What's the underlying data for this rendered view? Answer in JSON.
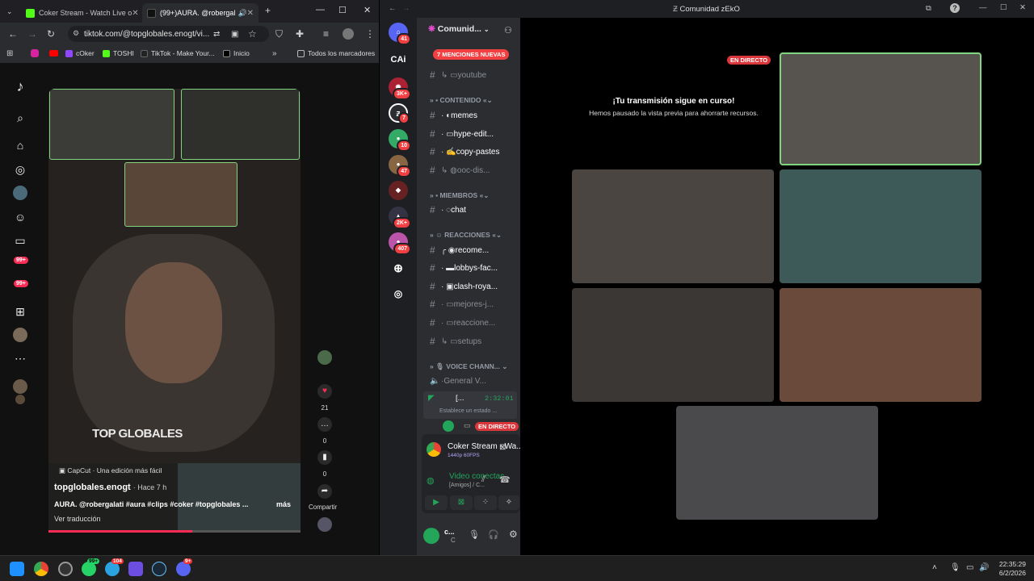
{
  "browser": {
    "tabs": [
      {
        "label": "Coker Stream - Watch Live o"
      },
      {
        "label": "(99+)AURA. @robergal"
      }
    ],
    "new_tab": "+",
    "address": "tiktok.com/@topglobales.enogt/vi...",
    "bookmarks": [
      "cOker",
      "TOSHI",
      "TikTok - Make Your...",
      "Inicio"
    ],
    "bookmarks_more": "»",
    "all_bookmarks": "Todos los marcadores"
  },
  "tiktok": {
    "sidebar_badges": [
      "99+",
      "99+"
    ],
    "overlay_text": "TOP GLOBALES",
    "capcut": "CapCut · Una edición más fácil",
    "author": "topglobales.enogt",
    "time": "· Hace 7 h",
    "caption": "AURA. @robergalati #aura #clips #coker #topglobales ...",
    "more": "más",
    "translate": "Ver traducción",
    "likes": "21",
    "comments": "0",
    "saves": "0",
    "share": "Compartir"
  },
  "discord": {
    "window_title": "Comunidad zEkO",
    "server_name": "Comunid...",
    "mentions_pill": "7 MENCIONES NUEVAS",
    "guild_badges": [
      "41",
      "3K+",
      "7",
      "10",
      "47",
      "2K+",
      "407"
    ],
    "guild_label_cai": "CAi",
    "channels": {
      "youtube": "youtube",
      "cat_contenido": "CONTENIDO",
      "memes": "memes",
      "hype": "hype-edit...",
      "copy": "copy-pastes",
      "ooc": "ooc-dis...",
      "cat_miembros": "MIEMBROS",
      "chat": "chat",
      "cat_reacciones": "REACCIONES",
      "recome": "recome...",
      "lobbys": "lobbys-fac...",
      "clash": "clash-roya...",
      "mejores": "mejores-j...",
      "reaccione": "reaccione...",
      "setups": "setups",
      "cat_voice": "VOICE CHANN...",
      "general": "General V...",
      "voice_user": "[...",
      "voice_timer": "2:32:01",
      "status_hint": "Establece un estado ...",
      "en_directo": "EN DIRECTO"
    },
    "stream_card": {
      "title": "Coker Stream - Wa...",
      "quality": "1440p 60FPS",
      "video_status": "Video conectac",
      "video_sub": "[Amigos] / C..."
    },
    "user_panel": {
      "name": "c...",
      "status": "C"
    },
    "stage": {
      "live_label": "EN DIRECTO",
      "paused_title": "¡Tu transmisión sigue en curso!",
      "paused_text": "Hemos pausado la vista previa para ahorrarte recursos."
    }
  },
  "taskbar": {
    "badges": [
      "99+",
      "104",
      "9+"
    ],
    "time": "22:35:29",
    "date": "6/2/2026"
  },
  "colors": {
    "live_red": "#da373c",
    "voice_green": "#23a55a",
    "tiktok_like": "#fe2c55",
    "border_green": "#7fd67e"
  }
}
